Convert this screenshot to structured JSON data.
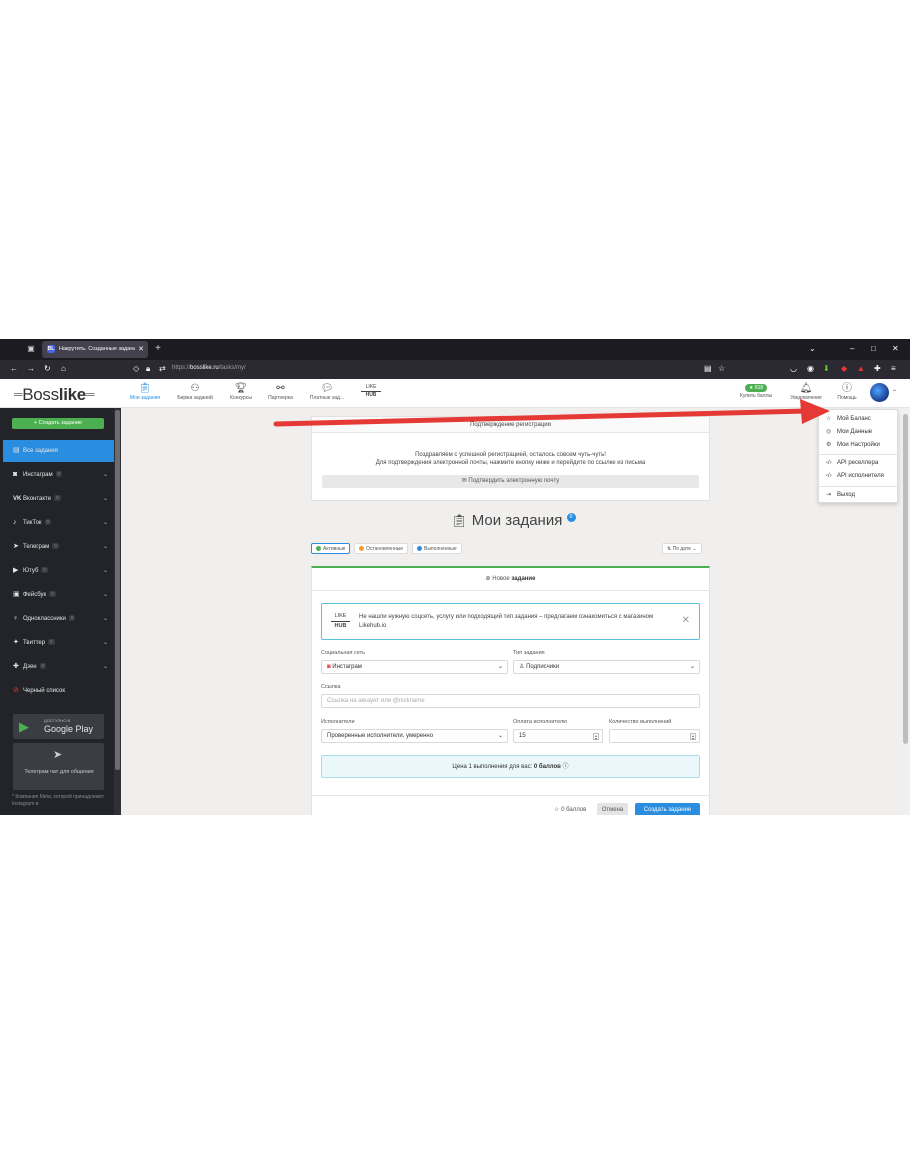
{
  "browser": {
    "tab_title": "Накрутить. Созданные задания",
    "tab_favicon": "BL",
    "url_host": "bosslike.ru",
    "url_prefix": "https://",
    "url_path": "/tasks/my/"
  },
  "header": {
    "logo_left": "Boss",
    "logo_right": "like",
    "nav": [
      {
        "label": "Мои задания",
        "icon": "clipboard-icon"
      },
      {
        "label": "Биржа заданий",
        "icon": "people-icon"
      },
      {
        "label": "Конкурсы",
        "icon": "trophy-icon"
      },
      {
        "label": "Партнерка",
        "icon": "handshake-icon"
      },
      {
        "label": "Платные зад...",
        "icon": "chat-icon"
      }
    ],
    "likehub_top": "LIKE",
    "likehub_bottom": "HUB",
    "balance": "818",
    "buy_points": "Купить баллы",
    "notifications": "Уведомления",
    "help": "Помощь"
  },
  "sidebar": {
    "create_button": "+ Создать задание",
    "items": [
      {
        "label": "Все задания",
        "icon": "list-icon",
        "count": "",
        "active": true
      },
      {
        "label": "Инстаграм",
        "icon": "instagram-icon",
        "count": "0"
      },
      {
        "label": "Вконтакте",
        "icon": "vk-icon",
        "count": "0"
      },
      {
        "label": "ТикТок",
        "icon": "tiktok-icon",
        "count": "0"
      },
      {
        "label": "Телеграм",
        "icon": "telegram-icon",
        "count": "0"
      },
      {
        "label": "Ютуб",
        "icon": "youtube-icon",
        "count": "0"
      },
      {
        "label": "Фейсбук",
        "icon": "facebook-icon",
        "count": "0"
      },
      {
        "label": "Одноклассники",
        "icon": "ok-icon",
        "count": "0"
      },
      {
        "label": "Твиттер",
        "icon": "twitter-icon",
        "count": "0"
      },
      {
        "label": "Дзен",
        "icon": "zen-icon",
        "count": "0"
      },
      {
        "label": "Черный список",
        "icon": "blacklist-icon",
        "count": ""
      }
    ],
    "gplay_small": "ДОСТУПНО В",
    "gplay_big": "Google Play",
    "telegram_chat": "Телеграм чат для общения",
    "disclaimer": "* Компания Meta, которой принадлежит Instagram и"
  },
  "registration": {
    "title": "Подтверждение регистрации",
    "line1": "Поздравляем с успешной регистрацией, осталось совсем чуть-чуть!",
    "line2": "Для подтверждения электронной почты, нажмите кнопку ниже и перейдите по ссылке из письма",
    "confirm_button": "Подтвердить электронную почту"
  },
  "tasks": {
    "title": "Мои задания",
    "count": "0",
    "filters": [
      {
        "label": "Активные",
        "color": "#4caf50"
      },
      {
        "label": "Остановленные",
        "color": "#f0a030"
      },
      {
        "label": "Выполненные",
        "color": "#2a8ee0"
      }
    ],
    "sort": "По дате"
  },
  "form": {
    "new_task_prefix": "Новое",
    "new_task_bold": "задание",
    "promo_text": "Не нашли нужную соцсеть, услугу или подходящий тип задания – предлагаем ознакомиться с магазином Likehub.io",
    "social_label": "Социальная сеть",
    "social_value": "Инстаграм",
    "type_label": "Тип задания",
    "type_value": "Подписчики",
    "link_label": "Ссылка",
    "link_placeholder": "Ссылка на аккаунт или @nickname",
    "executors_label": "Исполнители",
    "executors_value": "Проверенные исполнители, умеренно",
    "pay_label": "Оплата исполнителю",
    "pay_value": "15",
    "qty_label": "Количество выполнений",
    "qty_value": "",
    "price_text": "Цена 1 выполнения для вас:",
    "price_value": "0 баллов",
    "points": "0 баллов",
    "cancel": "Отмена",
    "create": "Создать задание"
  },
  "dropdown": {
    "items": [
      {
        "label": "Мой Баланс",
        "icon": "star-icon"
      },
      {
        "label": "Мои Данные",
        "icon": "user-circle-icon"
      },
      {
        "label": "Мои Настройки",
        "icon": "gears-icon"
      },
      {
        "label": "API реселлера",
        "icon": "code-icon"
      },
      {
        "label": "API исполнителя",
        "icon": "code-icon"
      },
      {
        "label": "Выход",
        "icon": "logout-icon"
      }
    ]
  },
  "colors": {
    "accent": "#2a8ee0",
    "success": "#4caf50",
    "arrow": "#e53935",
    "sidebar_bg": "#222429"
  }
}
